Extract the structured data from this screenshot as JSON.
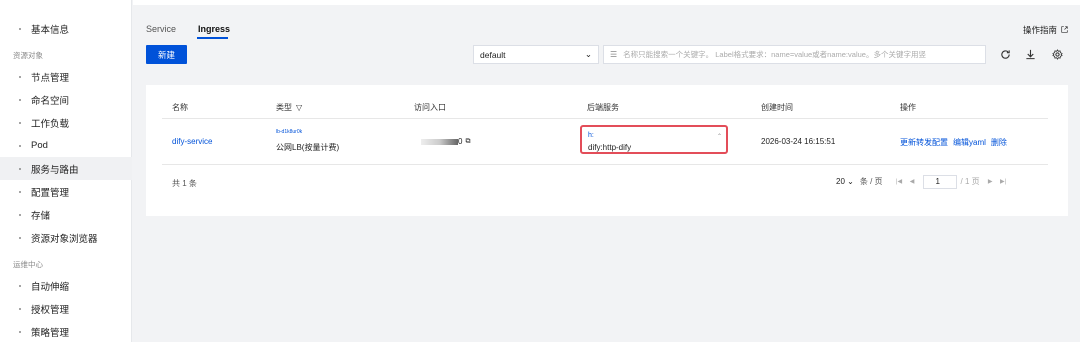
{
  "sidebar": {
    "items": [
      {
        "label": "基本信息"
      },
      {
        "label": "节点管理"
      },
      {
        "label": "命名空间"
      },
      {
        "label": "工作负载"
      },
      {
        "label": "Pod"
      },
      {
        "label": "服务与路由",
        "active": true
      },
      {
        "label": "配置管理"
      },
      {
        "label": "存储"
      },
      {
        "label": "资源对象浏览器"
      },
      {
        "label": "自动伸缩"
      },
      {
        "label": "授权管理"
      },
      {
        "label": "策略管理"
      }
    ],
    "groups": [
      "资源对象",
      "运维中心"
    ]
  },
  "tabs": [
    {
      "label": "Service"
    },
    {
      "label": "Ingress",
      "active": true
    }
  ],
  "guide_label": "操作指南",
  "toolbar": {
    "new_label": "新建",
    "namespace": "default",
    "search_placeholder": "名称只能搜索一个关键字。 Label格式要求：name=value或者name:value。多个关键字用竖"
  },
  "table": {
    "headers": [
      "名称",
      "类型",
      "访问入口",
      "后端服务",
      "创建时间",
      "操作"
    ],
    "rows": [
      {
        "name": "dify-service",
        "type_sub": "lb-d1k8ur0k",
        "type": "公网LB(按量计费)",
        "access": "0",
        "backend_prefix": "h:",
        "backend": "dify:http-dify",
        "created": "2026-03-24 16:15:51",
        "ops": [
          "更新转发配置",
          "编辑yaml",
          "删除"
        ]
      }
    ],
    "total": "共 1 条",
    "page_size": "20",
    "page_size_unit": "条 / 页",
    "current_page": "1",
    "page_total": "/ 1 页"
  },
  "colors": {
    "accent": "#0052d9",
    "highlight": "#e34d59"
  }
}
